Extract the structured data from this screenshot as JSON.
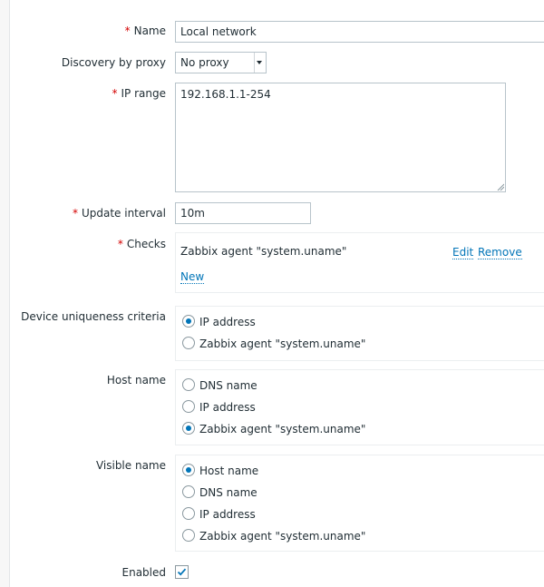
{
  "form": {
    "name": {
      "label": "Name",
      "value": "Local network"
    },
    "proxy": {
      "label": "Discovery by proxy",
      "value": "No proxy"
    },
    "ip_range": {
      "label": "IP range",
      "value": "192.168.1.1-254"
    },
    "update_interval": {
      "label": "Update interval",
      "value": "10m"
    },
    "checks": {
      "label": "Checks",
      "items": [
        {
          "text": "Zabbix agent \"system.uname\"",
          "edit": "Edit",
          "remove": "Remove"
        }
      ],
      "new_label": "New"
    },
    "uniqueness": {
      "label": "Device uniqueness criteria",
      "options": [
        "IP address",
        "Zabbix agent \"system.uname\""
      ],
      "selected": "IP address"
    },
    "host_name": {
      "label": "Host name",
      "options": [
        "DNS name",
        "IP address",
        "Zabbix agent \"system.uname\""
      ],
      "selected": "Zabbix agent \"system.uname\""
    },
    "visible_name": {
      "label": "Visible name",
      "options": [
        "Host name",
        "DNS name",
        "IP address",
        "Zabbix agent \"system.uname\""
      ],
      "selected": "Host name"
    },
    "enabled": {
      "label": "Enabled",
      "checked": true
    }
  },
  "icons": {
    "required_marker": "*",
    "select_arrow": "triangle-down",
    "checkbox_check": "checkmark"
  },
  "colors": {
    "accent": "#0275b8",
    "required": "#d40000",
    "text": "#1f2c33"
  }
}
